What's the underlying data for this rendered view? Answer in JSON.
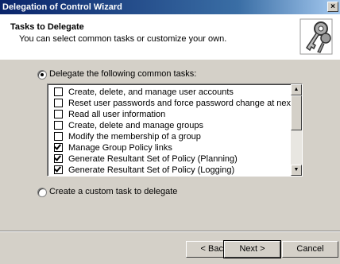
{
  "window": {
    "title": "Delegation of Control Wizard",
    "close_glyph": "×"
  },
  "header": {
    "title": "Tasks to Delegate",
    "subtitle": "You can select common tasks or customize your own.",
    "icon": "keys-icon"
  },
  "options": {
    "common": {
      "label": "Delegate the following common tasks:",
      "checked": true
    },
    "custom": {
      "label": "Create a custom task to delegate",
      "checked": false
    }
  },
  "tasks": [
    {
      "label": "Create, delete, and manage user accounts",
      "checked": false
    },
    {
      "label": "Reset user passwords and force password change at next logon",
      "checked": false
    },
    {
      "label": "Read all user information",
      "checked": false
    },
    {
      "label": "Create, delete and manage groups",
      "checked": false
    },
    {
      "label": "Modify the membership of a group",
      "checked": false
    },
    {
      "label": "Manage Group Policy links",
      "checked": true
    },
    {
      "label": "Generate Resultant Set of Policy (Planning)",
      "checked": true
    },
    {
      "label": "Generate Resultant Set of Policy (Logging)",
      "checked": true
    }
  ],
  "buttons": {
    "back": "< Back",
    "next": "Next >",
    "cancel": "Cancel"
  }
}
